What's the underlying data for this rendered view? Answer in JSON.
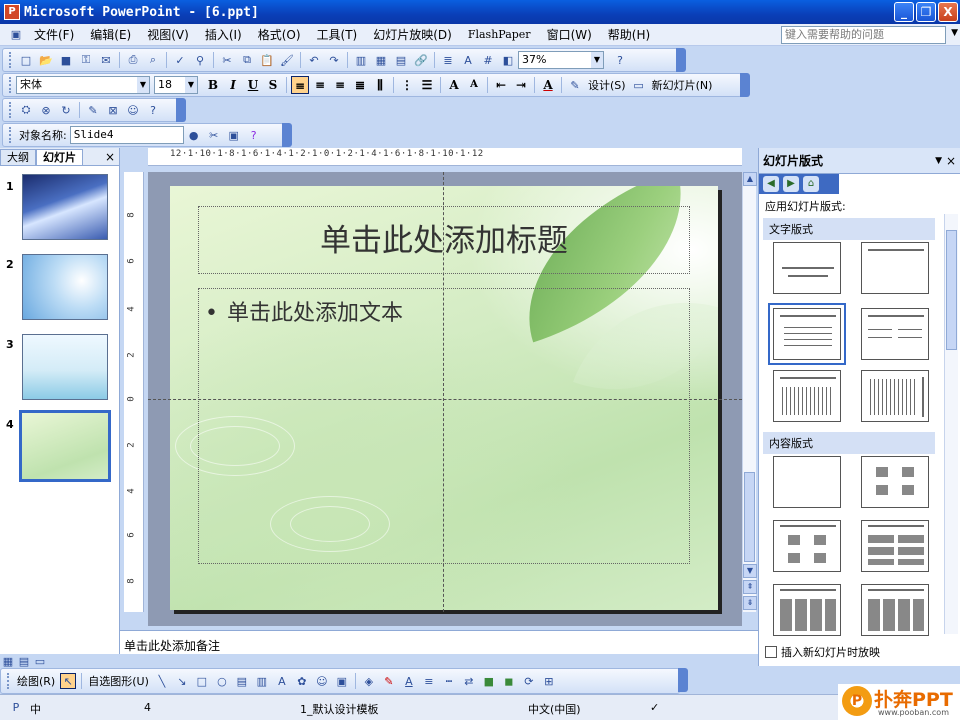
{
  "window": {
    "title": "Microsoft PowerPoint - [6.ppt]",
    "controls": [
      "_",
      "❐",
      "X"
    ]
  },
  "menu": {
    "items": [
      "文件(F)",
      "编辑(E)",
      "视图(V)",
      "插入(I)",
      "格式(O)",
      "工具(T)",
      "幻灯片放映(D)",
      "FlashPaper",
      "窗口(W)",
      "帮助(H)"
    ],
    "help_placeholder": "键入需要帮助的问题"
  },
  "standard_toolbar": {
    "zoom": "37%"
  },
  "format_toolbar": {
    "font": "宋体",
    "size": "18",
    "bold": "B",
    "italic": "I",
    "underline": "U",
    "shadow": "S",
    "design_label": "设计(S)",
    "new_slide_label": "新幻灯片(N)"
  },
  "object_bar": {
    "label": "对象名称:",
    "value": "Slide4"
  },
  "left_panel": {
    "tab_outline": "大纲",
    "tab_slides": "幻灯片",
    "close": "×",
    "thumbnails": [
      {
        "num": "1"
      },
      {
        "num": "2"
      },
      {
        "num": "3"
      },
      {
        "num": "4"
      }
    ]
  },
  "ruler": {
    "top": "12·1·10·1·8·1·6·1·4·1·2·1·0·1·2·1·4·1·6·1·8·1·10·1·12",
    "left": [
      "8",
      "6",
      "4",
      "2",
      "0",
      "2",
      "4",
      "6",
      "8"
    ]
  },
  "slide": {
    "title_placeholder": "单击此处添加标题",
    "bullet": "•",
    "body_placeholder": "单击此处添加文本"
  },
  "notes": {
    "placeholder": "单击此处添加备注"
  },
  "task_pane": {
    "title": "幻灯片版式",
    "apply_label": "应用幻灯片版式:",
    "section_text": "文字版式",
    "section_content": "内容版式",
    "show_on_insert": "插入新幻灯片时放映"
  },
  "drawing_toolbar": {
    "draw_label": "绘图(R)",
    "autoshapes_label": "自选图形(U)"
  },
  "status": {
    "slide_number": "4",
    "design": "1_默认设计模板",
    "language": "中文(中国)"
  },
  "watermark": {
    "brand": "扑奔PPT",
    "url": "www.pooban.com"
  },
  "colors": {
    "title_bar": "#0a4fd0",
    "accent": "#3468c8",
    "slide_bg": "#d4ecc4"
  }
}
